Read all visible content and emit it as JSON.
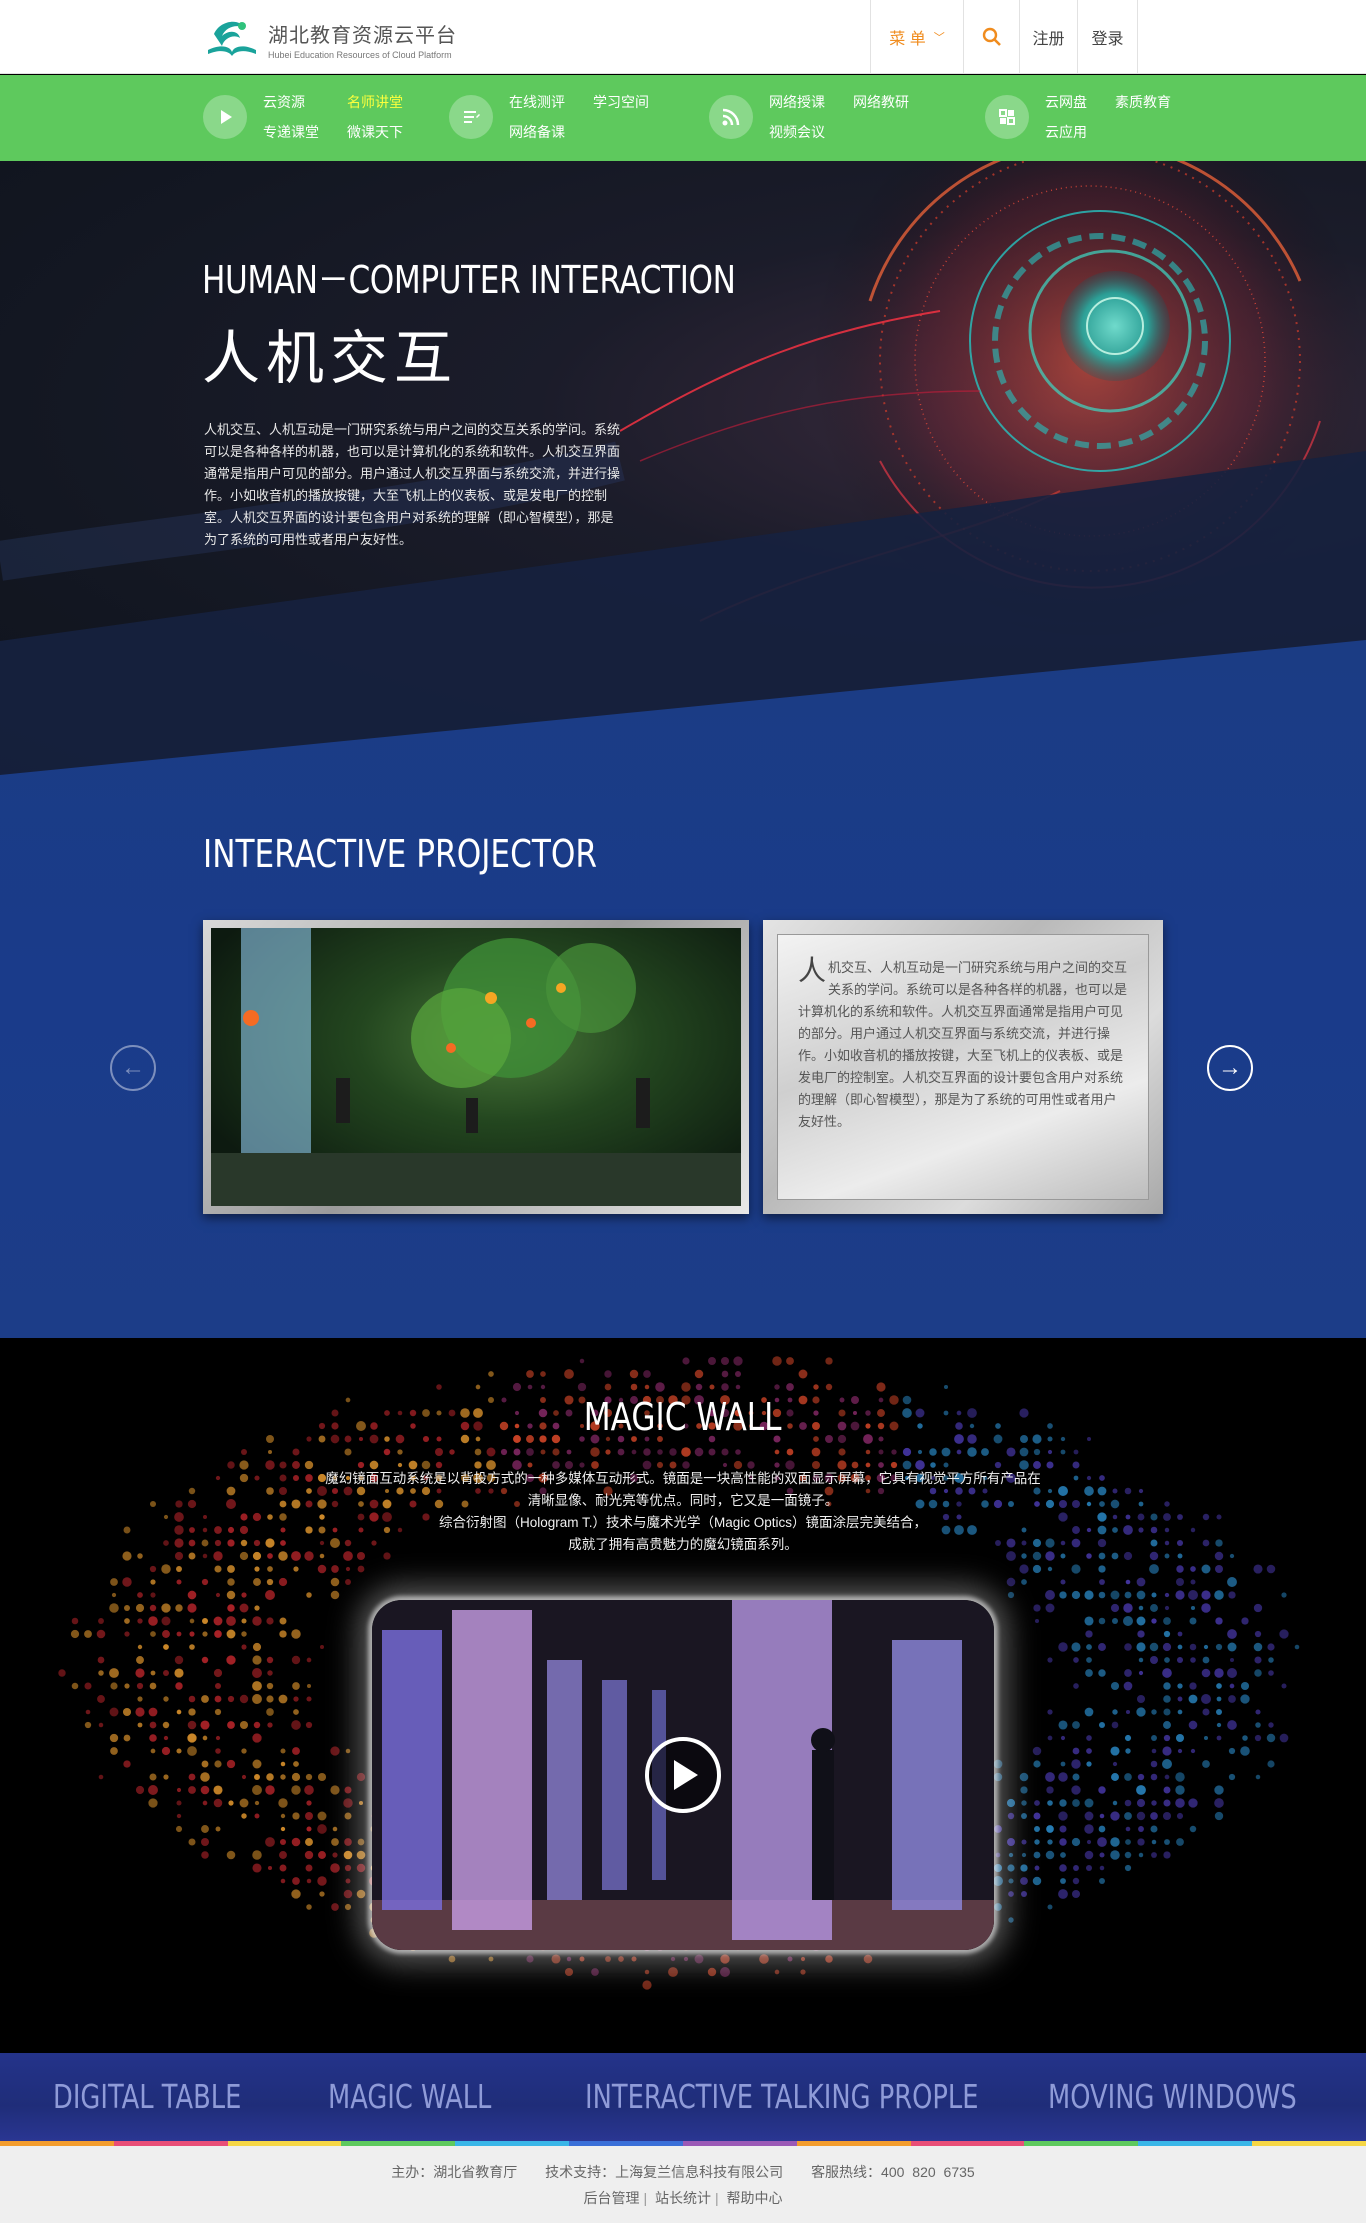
{
  "header": {
    "logo_title": "湖北教育资源云平台",
    "logo_subtitle": "Hubei Education Resources of Cloud Platform",
    "menu_label": "菜 单",
    "register_label": "注册",
    "login_label": "登录",
    "icons": [
      "logo-icon",
      "chevron-down-icon",
      "search-icon"
    ]
  },
  "nav": {
    "groups": [
      {
        "icon": "play-icon",
        "links": [
          "云资源",
          "名师讲堂",
          "专递课堂",
          "微课天下"
        ],
        "highlight": "名师讲堂"
      },
      {
        "icon": "edit-icon",
        "links": [
          "在线测评",
          "学习空间",
          "网络备课"
        ]
      },
      {
        "icon": "rss-icon",
        "links": [
          "网络授课",
          "网络教研",
          "视频会议"
        ]
      },
      {
        "icon": "cloud-apps-icon",
        "links": [
          "云网盘",
          "素质教育",
          "云应用"
        ]
      }
    ],
    "highlight_color": "#fbff3d",
    "bg_color": "#5ec95d"
  },
  "hero": {
    "title_en": "HUMAN－COMPUTER INTERACTION",
    "title_cn": "人机交互",
    "description": "人机交互、人机互动是一门研究系统与用户之间的交互关系的学问。系统可以是各种各样的机器，也可以是计算机化的系统和软件。人机交互界面通常是指用户可见的部分。用户通过人机交互界面与系统交流，并进行操作。小如收音机的播放按键，大至飞机上的仪表板、或是发电厂的控制室。人机交互界面的设计要包含用户对系统的理解（即心智模型），那是为了系统的可用性或者用户友好性。"
  },
  "projector": {
    "title": "INTERACTIVE PROJECTOR",
    "card_first_char": "人",
    "card_text": "机交互、人机互动是一门研究系统与用户之间的交互关系的学问。系统可以是各种各样的机器，也可以是计算机化的系统和软件。人机交互界面通常是指用户可见的部分。用户通过人机交互界面与系统交流，并进行操作。小如收音机的播放按键，大至飞机上的仪表板、或是发电厂的控制室。人机交互界面的设计要包含用户对系统的理解（即心智模型），那是为了系统的可用性或者用户友好性。",
    "icons": [
      "arrow-left-icon",
      "arrow-right-icon"
    ]
  },
  "magic_wall": {
    "title": "MAGIC WALL",
    "desc_line1": "魔幻镜面互动系统是以背投方式的一种多媒体互动形式。镜面是一块高性能的双面显示屏幕，它具有视觉平方所有产品在",
    "desc_line2": "清晰显像、耐光亮等优点。同时，它又是一面镜子。",
    "desc_line3": "综合衍射图（Hologram T.）技术与魔术光学（Magic Optics）镜面涂层完美结合，",
    "desc_line4": "成就了拥有高贵魅力的魔幻镜面系列。",
    "icons": [
      "play-icon"
    ]
  },
  "tabs": [
    "DIGITAL TABLE",
    "MAGIC WALL",
    "INTERACTIVE TALKING PROPLE",
    "MOVING WINDOWS"
  ],
  "colorbar": [
    "#f39c2c",
    "#e94e77",
    "#f6d645",
    "#5ec95d",
    "#39b6e8",
    "#3a6fd8",
    "#9b59b6",
    "#f39c2c",
    "#e94e77",
    "#5ec95d",
    "#39b6e8",
    "#f6d645"
  ],
  "footer": {
    "host": "主办：湖北省教育厅",
    "tech": "技术支持：上海复兰信息科技有限公司",
    "hotline": "客服热线：400 820 6735",
    "links": [
      "后台管理",
      "站长统计",
      "帮助中心"
    ]
  }
}
